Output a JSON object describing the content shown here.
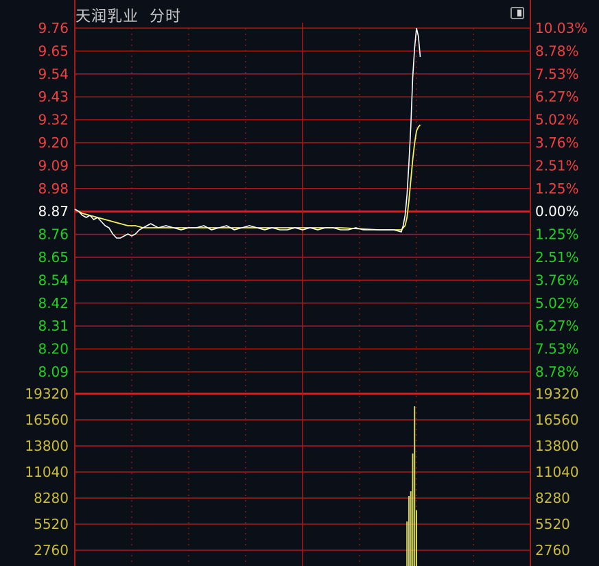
{
  "header": {
    "stock_name": "天润乳业",
    "view_mode": "分时"
  },
  "colors": {
    "background": "#0b0f18",
    "grid": "#b01818",
    "baseline": "#e01a1a",
    "up": "#f04040",
    "down": "#22d022",
    "neutral": "#ffffff",
    "volume_text": "#c8bc3a",
    "volume_bar": "#d6d65a",
    "price_line": "#ffffff",
    "avg_line": "#f2f25a"
  },
  "chart_data": {
    "type": "line",
    "title": "天润乳业 分时",
    "prev_close": 8.87,
    "price_axis": {
      "ticks": [
        "9.76",
        "9.65",
        "9.54",
        "9.43",
        "9.32",
        "9.20",
        "9.09",
        "8.98",
        "8.87",
        "8.76",
        "8.65",
        "8.54",
        "8.42",
        "8.31",
        "8.20",
        "8.09"
      ],
      "ylim": [
        8.09,
        9.76
      ]
    },
    "pct_axis": {
      "ticks": [
        "10.03%",
        "8.78%",
        "7.53%",
        "6.27%",
        "5.02%",
        "3.76%",
        "2.51%",
        "1.25%",
        "0.00%",
        "1.25%",
        "2.51%",
        "3.76%",
        "5.02%",
        "6.27%",
        "7.53%",
        "8.78%"
      ]
    },
    "volume_axis": {
      "ticks": [
        "19320",
        "16560",
        "13800",
        "11040",
        "8280",
        "5520",
        "2760"
      ],
      "ylim": [
        0,
        19320
      ]
    },
    "session_minutes": 240,
    "price_series": {
      "name": "price",
      "points": [
        [
          0,
          8.88
        ],
        [
          2,
          8.87
        ],
        [
          4,
          8.85
        ],
        [
          6,
          8.84
        ],
        [
          8,
          8.85
        ],
        [
          10,
          8.83
        ],
        [
          12,
          8.84
        ],
        [
          14,
          8.82
        ],
        [
          16,
          8.8
        ],
        [
          18,
          8.79
        ],
        [
          20,
          8.76
        ],
        [
          22,
          8.74
        ],
        [
          24,
          8.74
        ],
        [
          26,
          8.75
        ],
        [
          28,
          8.76
        ],
        [
          30,
          8.75
        ],
        [
          32,
          8.76
        ],
        [
          34,
          8.78
        ],
        [
          36,
          8.79
        ],
        [
          38,
          8.8
        ],
        [
          40,
          8.81
        ],
        [
          44,
          8.79
        ],
        [
          48,
          8.8
        ],
        [
          52,
          8.79
        ],
        [
          56,
          8.78
        ],
        [
          60,
          8.79
        ],
        [
          64,
          8.79
        ],
        [
          68,
          8.8
        ],
        [
          72,
          8.78
        ],
        [
          76,
          8.79
        ],
        [
          80,
          8.8
        ],
        [
          84,
          8.78
        ],
        [
          88,
          8.79
        ],
        [
          92,
          8.8
        ],
        [
          96,
          8.79
        ],
        [
          100,
          8.78
        ],
        [
          104,
          8.79
        ],
        [
          108,
          8.78
        ],
        [
          112,
          8.78
        ],
        [
          116,
          8.79
        ],
        [
          120,
          8.78
        ],
        [
          124,
          8.79
        ],
        [
          128,
          8.78
        ],
        [
          132,
          8.79
        ],
        [
          136,
          8.79
        ],
        [
          140,
          8.78
        ],
        [
          144,
          8.78
        ],
        [
          148,
          8.79
        ],
        [
          152,
          8.78
        ],
        [
          156,
          8.78
        ],
        [
          160,
          8.78
        ],
        [
          164,
          8.78
        ],
        [
          168,
          8.78
        ],
        [
          172,
          8.77
        ],
        [
          173,
          8.8
        ],
        [
          174,
          8.85
        ],
        [
          175,
          8.95
        ],
        [
          176,
          9.1
        ],
        [
          177,
          9.28
        ],
        [
          178,
          9.52
        ],
        [
          179,
          9.66
        ],
        [
          180,
          9.76
        ],
        [
          181,
          9.72
        ],
        [
          182,
          9.62
        ]
      ],
      "values_note": ""
    },
    "avg_series": {
      "name": "avg",
      "points": [
        [
          0,
          8.88
        ],
        [
          4,
          8.86
        ],
        [
          8,
          8.85
        ],
        [
          12,
          8.84
        ],
        [
          16,
          8.83
        ],
        [
          20,
          8.82
        ],
        [
          24,
          8.81
        ],
        [
          28,
          8.8
        ],
        [
          32,
          8.8
        ],
        [
          36,
          8.79
        ],
        [
          40,
          8.79
        ],
        [
          60,
          8.79
        ],
        [
          80,
          8.79
        ],
        [
          100,
          8.79
        ],
        [
          120,
          8.79
        ],
        [
          140,
          8.79
        ],
        [
          160,
          8.78
        ],
        [
          172,
          8.78
        ],
        [
          174,
          8.8
        ],
        [
          175,
          8.84
        ],
        [
          176,
          8.92
        ],
        [
          177,
          9.02
        ],
        [
          178,
          9.12
        ],
        [
          179,
          9.2
        ],
        [
          180,
          9.26
        ],
        [
          181,
          9.28
        ],
        [
          182,
          9.29
        ]
      ]
    },
    "volume_series": {
      "name": "volume",
      "points": [
        [
          0,
          700
        ],
        [
          175,
          5800
        ],
        [
          176,
          8500
        ],
        [
          177,
          9000
        ],
        [
          178,
          13000
        ],
        [
          179,
          18000
        ],
        [
          180,
          7000
        ]
      ]
    }
  }
}
